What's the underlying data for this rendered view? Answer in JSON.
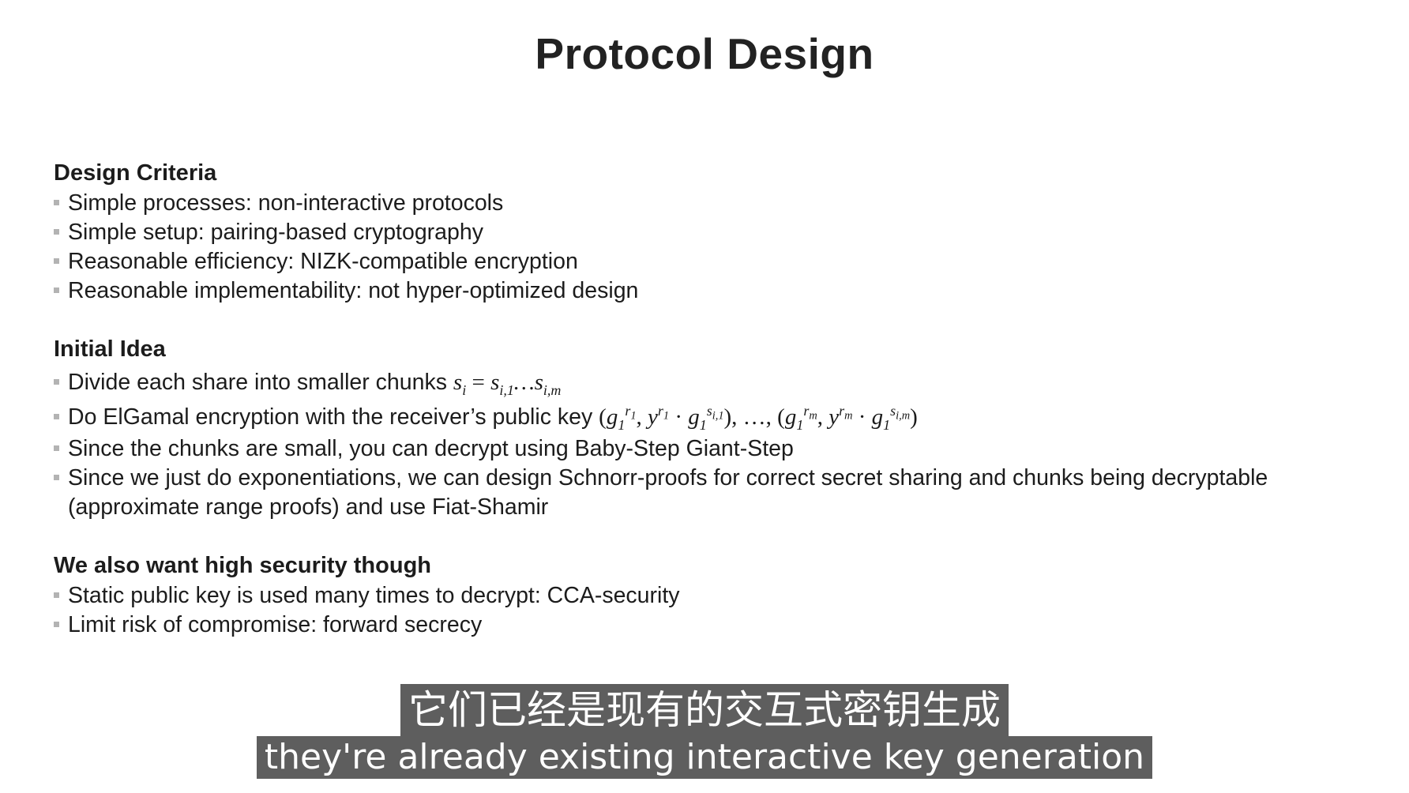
{
  "slide": {
    "title": "Protocol Design"
  },
  "sections": {
    "design_criteria": {
      "heading": "Design Criteria",
      "items": [
        "Simple processes: non-interactive protocols",
        "Simple setup: pairing-based cryptography",
        "Reasonable efficiency: NIZK-compatible encryption",
        "Reasonable implementability: not hyper-optimized design"
      ]
    },
    "initial_idea": {
      "heading": "Initial Idea",
      "item_chunks": "Divide each share into smaller chunks",
      "item_elgamal": "Do ElGamal encryption with the receiver’s public key",
      "item_baby_step": "Since the chunks are small, you can decrypt using Baby-Step Giant-Step",
      "item_schnorr": "Since we just do exponentiations, we can design Schnorr-proofs for correct secret sharing and chunks being decryptable (approximate range proofs) and use Fiat-Shamir"
    },
    "security": {
      "heading": "We also want high security though",
      "items": [
        "Static public key is used many times to decrypt: CCA-security",
        "Limit risk of compromise: forward secrecy"
      ]
    }
  },
  "subtitles": {
    "chinese": "它们已经是现有的交互式密钥生成",
    "english": "they're already existing interactive key generation"
  }
}
